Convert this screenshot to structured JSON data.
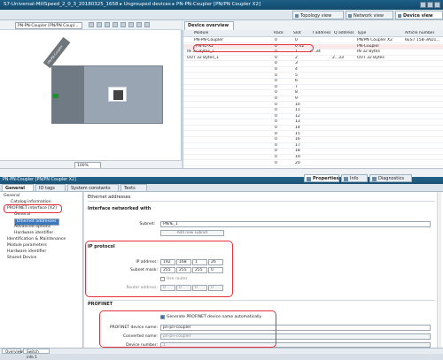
{
  "window": {
    "title": "S7-Universal-MillSpeed_2_0_3_20180325_1658 ▸ Ungrouped devices ▸ PN-PN-Coupler [PN/PN Coupler X2]"
  },
  "view_tabs": [
    "Topology view",
    "Network view",
    "Device view"
  ],
  "network_view": {
    "device_select": "PN-PN-Coupler [PN/PN Coupl...",
    "device_label": "PN-PN-Coupler",
    "zoom": "100%"
  },
  "device_overview": {
    "tab": "Device overview",
    "columns": [
      "Module",
      "Rack",
      "Slot",
      "I address",
      "Q address",
      "Type",
      "Article number"
    ],
    "rows": [
      {
        "module": "PN-PN-Coupler",
        "rack": "0",
        "slot": "0",
        "i": "",
        "q": "",
        "type": "PN/PN Coupler X2",
        "article": "6ES7 158-3AD1..."
      },
      {
        "module": "PN-IO-X2",
        "rack": "0",
        "slot": "0 X2",
        "i": "",
        "q": "",
        "type": "PN-Coupler",
        "article": ""
      },
      {
        "module": "IN 32 Bytes_1",
        "rack": "0",
        "slot": "1",
        "i": "2...34",
        "q": "",
        "type": "IN 32 Bytes",
        "article": ""
      },
      {
        "module": "OUT 32 Bytes_1",
        "rack": "0",
        "slot": "2",
        "i": "",
        "q": "2...33",
        "type": "OUT 32 Bytes",
        "article": ""
      },
      {
        "module": "",
        "rack": "0",
        "slot": "3",
        "i": "",
        "q": "",
        "type": "",
        "article": ""
      },
      {
        "module": "",
        "rack": "0",
        "slot": "4",
        "i": "",
        "q": "",
        "type": "",
        "article": ""
      },
      {
        "module": "",
        "rack": "0",
        "slot": "5",
        "i": "",
        "q": "",
        "type": "",
        "article": ""
      },
      {
        "module": "",
        "rack": "0",
        "slot": "6",
        "i": "",
        "q": "",
        "type": "",
        "article": ""
      },
      {
        "module": "",
        "rack": "0",
        "slot": "7",
        "i": "",
        "q": "",
        "type": "",
        "article": ""
      },
      {
        "module": "",
        "rack": "0",
        "slot": "8",
        "i": "",
        "q": "",
        "type": "",
        "article": ""
      },
      {
        "module": "",
        "rack": "0",
        "slot": "9",
        "i": "",
        "q": "",
        "type": "",
        "article": ""
      },
      {
        "module": "",
        "rack": "0",
        "slot": "10",
        "i": "",
        "q": "",
        "type": "",
        "article": ""
      },
      {
        "module": "",
        "rack": "0",
        "slot": "11",
        "i": "",
        "q": "",
        "type": "",
        "article": ""
      },
      {
        "module": "",
        "rack": "0",
        "slot": "12",
        "i": "",
        "q": "",
        "type": "",
        "article": ""
      },
      {
        "module": "",
        "rack": "0",
        "slot": "13",
        "i": "",
        "q": "",
        "type": "",
        "article": ""
      },
      {
        "module": "",
        "rack": "0",
        "slot": "14",
        "i": "",
        "q": "",
        "type": "",
        "article": ""
      },
      {
        "module": "",
        "rack": "0",
        "slot": "15",
        "i": "",
        "q": "",
        "type": "",
        "article": ""
      },
      {
        "module": "",
        "rack": "0",
        "slot": "16",
        "i": "",
        "q": "",
        "type": "",
        "article": ""
      },
      {
        "module": "",
        "rack": "0",
        "slot": "17",
        "i": "",
        "q": "",
        "type": "",
        "article": ""
      },
      {
        "module": "",
        "rack": "0",
        "slot": "18",
        "i": "",
        "q": "",
        "type": "",
        "article": ""
      },
      {
        "module": "",
        "rack": "0",
        "slot": "19",
        "i": "",
        "q": "",
        "type": "",
        "article": ""
      },
      {
        "module": "",
        "rack": "0",
        "slot": "20",
        "i": "",
        "q": "",
        "type": "",
        "article": ""
      }
    ]
  },
  "properties_panel": {
    "title": "PN-PN-Coupler [PN/PN Coupler X2]",
    "right_tabs": [
      "Properties",
      "Info",
      "Diagnostics"
    ],
    "sub_tabs": [
      "General",
      "IO tags",
      "System constants",
      "Texts"
    ]
  },
  "nav": {
    "items": [
      "General",
      "Catalog information",
      "PROFINET interface [X2]",
      "General",
      "Ethernet addresses",
      "Advanced options",
      "Hardware identifier",
      "Identification & Maintenance",
      "Module parameters",
      "Hardware identifier",
      "Shared Device"
    ]
  },
  "ethernet": {
    "section": "Ethernet addresses",
    "networked_header": "Interface networked with",
    "subnet_label": "Subnet:",
    "subnet_value": "PN/IE_1",
    "add_subnet": "Add new subnet",
    "ip_header": "IP protocol",
    "ip_label": "IP address:",
    "ip": [
      "192",
      "168",
      "1",
      "26"
    ],
    "mask_label": "Subnet mask:",
    "mask": [
      "255",
      "255",
      "255",
      "0"
    ],
    "use_router": "Use router",
    "router_label": "Router address:",
    "router": [
      "0",
      "0",
      "0",
      "0"
    ],
    "profinet_header": "PROFINET",
    "gen_name_label": "Generate PROFINET device name automatically",
    "dev_name_label": "PROFINET device name:",
    "dev_name_value": "pn-pn-coupler",
    "conv_name_label": "Converted name:",
    "conv_name_value": "pn-pn-coupler",
    "dev_number_label": "Device number:",
    "dev_number_value": "1"
  },
  "bottom_tabs": [
    "Overview",
    "Switch info 1"
  ]
}
